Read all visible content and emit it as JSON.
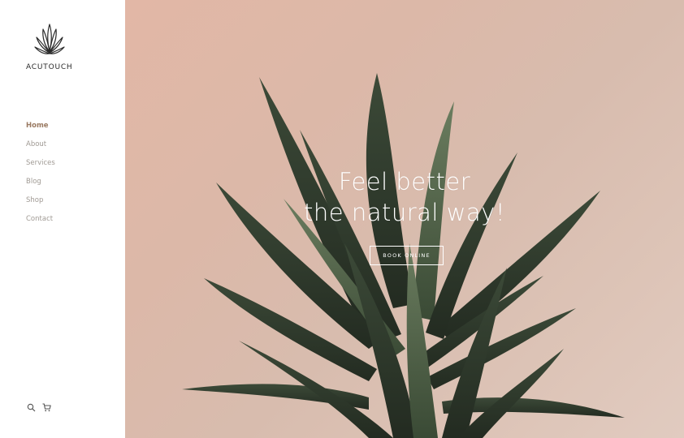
{
  "brand": {
    "name": "ACUTOUCH",
    "logo_icon": "lotus-icon"
  },
  "nav": {
    "items": [
      {
        "label": "Home",
        "active": true
      },
      {
        "label": "About",
        "active": false
      },
      {
        "label": "Services",
        "active": false
      },
      {
        "label": "Blog",
        "active": false
      },
      {
        "label": "Shop",
        "active": false
      },
      {
        "label": "Contact",
        "active": false
      }
    ]
  },
  "sidebar_icons": [
    "search-icon",
    "cart-icon"
  ],
  "hero": {
    "headline_line1": "Feel better",
    "headline_line2": "the natural way!",
    "cta_label": "BOOK ONLINE",
    "image_subject": "agave-plant"
  },
  "colors": {
    "nav_active": "#9a7a62",
    "nav_inactive": "#a09a94",
    "hero_background": "#dcb8a8",
    "plant_dark": "#2f3a2e",
    "plant_light": "#55664e"
  }
}
